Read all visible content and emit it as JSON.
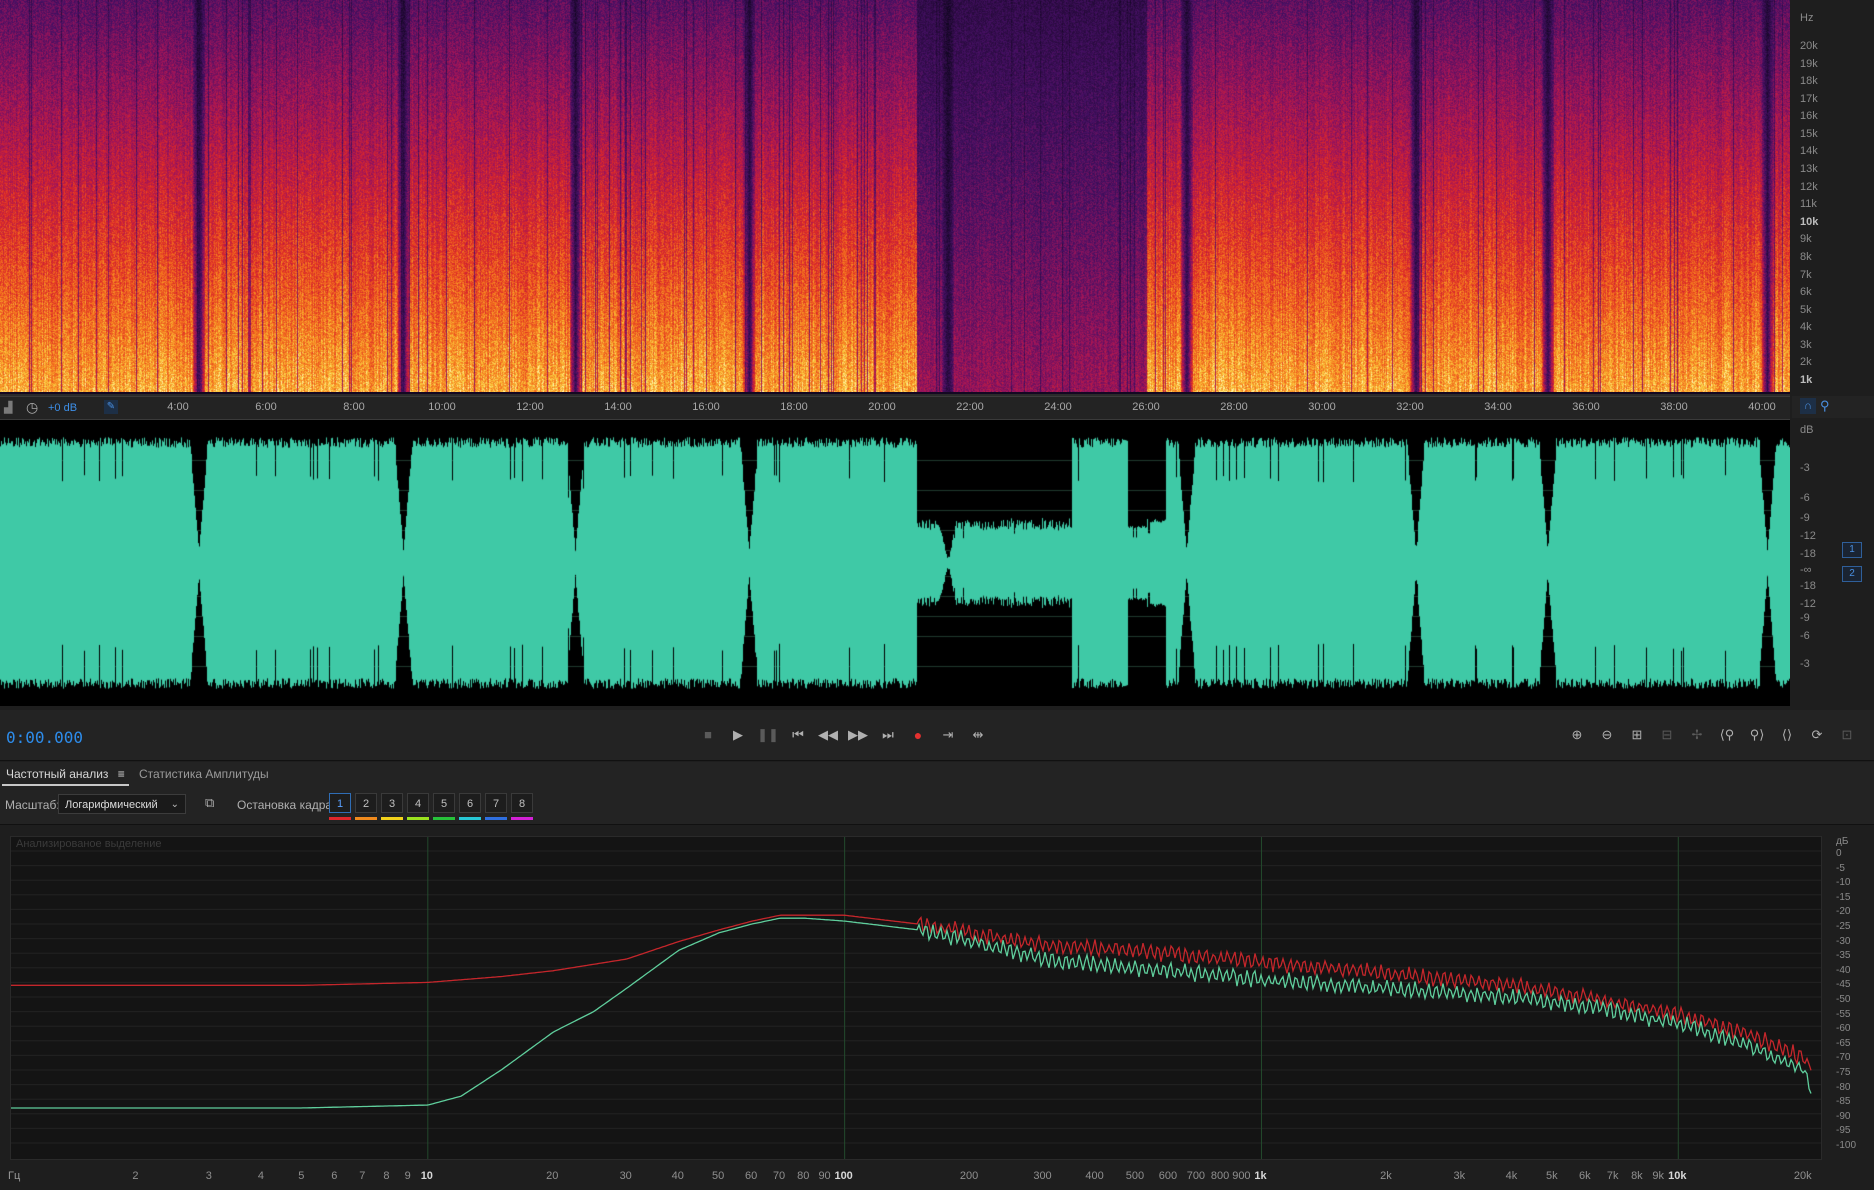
{
  "spectrogram": {
    "unit_label": "Hz",
    "ticks": [
      {
        "label": "20k",
        "bold": false
      },
      {
        "label": "19k",
        "bold": false
      },
      {
        "label": "18k",
        "bold": false
      },
      {
        "label": "17k",
        "bold": false
      },
      {
        "label": "16k",
        "bold": false
      },
      {
        "label": "15k",
        "bold": false
      },
      {
        "label": "14k",
        "bold": false
      },
      {
        "label": "13k",
        "bold": false
      },
      {
        "label": "12k",
        "bold": false
      },
      {
        "label": "11k",
        "bold": false
      },
      {
        "label": "10k",
        "bold": true
      },
      {
        "label": "9k",
        "bold": false
      },
      {
        "label": "8k",
        "bold": false
      },
      {
        "label": "7k",
        "bold": false
      },
      {
        "label": "6k",
        "bold": false
      },
      {
        "label": "5k",
        "bold": false
      },
      {
        "label": "4k",
        "bold": false
      },
      {
        "label": "3k",
        "bold": false
      },
      {
        "label": "2k",
        "bold": false
      },
      {
        "label": "1k",
        "bold": true
      }
    ]
  },
  "timeline": {
    "gain_label": "+0 dB",
    "labels": [
      "4:00",
      "6:00",
      "8:00",
      "10:00",
      "12:00",
      "14:00",
      "16:00",
      "18:00",
      "20:00",
      "22:00",
      "24:00",
      "26:00",
      "28:00",
      "30:00",
      "32:00",
      "34:00",
      "36:00",
      "38:00",
      "40:00"
    ]
  },
  "waveform": {
    "color": "#3fc9a6",
    "db_unit": "dB",
    "db_ticks": [
      "-3",
      "-6",
      "-9",
      "-12",
      "-18",
      "-∞",
      "-18",
      "-12",
      "-9",
      "-6",
      "-3"
    ],
    "channels": [
      "1",
      "2"
    ]
  },
  "transport": {
    "time": "0:00.000"
  },
  "panel": {
    "tabs": [
      {
        "label": "Частотный анализ",
        "active": true
      },
      {
        "label": "Статистика Амплитуды",
        "active": false
      }
    ],
    "scale_label": "Масштаб:",
    "scale_value": "Логарифмический",
    "freeze_label": "Остановка кадра:",
    "frames": [
      {
        "label": "1",
        "color": "#e0262b"
      },
      {
        "label": "2",
        "color": "#f08a1d"
      },
      {
        "label": "3",
        "color": "#f2d21b"
      },
      {
        "label": "4",
        "color": "#9be31f"
      },
      {
        "label": "5",
        "color": "#27c13a"
      },
      {
        "label": "6",
        "color": "#27c8d6"
      },
      {
        "label": "7",
        "color": "#2f6fe0"
      },
      {
        "label": "8",
        "color": "#d321d6"
      }
    ]
  },
  "freq_analysis": {
    "overlay_label": "Анализированое выделение",
    "db_unit": "дБ",
    "db_ticks": [
      "0",
      "-5",
      "-10",
      "-15",
      "-20",
      "-25",
      "-30",
      "-35",
      "-40",
      "-45",
      "-50",
      "-55",
      "-60",
      "-65",
      "-70",
      "-75",
      "-80",
      "-85",
      "-90",
      "-95",
      "-100"
    ],
    "x_unit": "Гц",
    "x_ticks": [
      {
        "label": "2",
        "hz": 2,
        "bold": false
      },
      {
        "label": "3",
        "hz": 3,
        "bold": false
      },
      {
        "label": "4",
        "hz": 4,
        "bold": false
      },
      {
        "label": "5",
        "hz": 5,
        "bold": false
      },
      {
        "label": "6",
        "hz": 6,
        "bold": false
      },
      {
        "label": "7",
        "hz": 7,
        "bold": false
      },
      {
        "label": "8",
        "hz": 8,
        "bold": false
      },
      {
        "label": "9",
        "hz": 9,
        "bold": false
      },
      {
        "label": "10",
        "hz": 10,
        "bold": true
      },
      {
        "label": "20",
        "hz": 20,
        "bold": false
      },
      {
        "label": "30",
        "hz": 30,
        "bold": false
      },
      {
        "label": "40",
        "hz": 40,
        "bold": false
      },
      {
        "label": "50",
        "hz": 50,
        "bold": false
      },
      {
        "label": "60",
        "hz": 60,
        "bold": false
      },
      {
        "label": "70",
        "hz": 70,
        "bold": false
      },
      {
        "label": "80",
        "hz": 80,
        "bold": false
      },
      {
        "label": "90",
        "hz": 90,
        "bold": false
      },
      {
        "label": "100",
        "hz": 100,
        "bold": true
      },
      {
        "label": "200",
        "hz": 200,
        "bold": false
      },
      {
        "label": "300",
        "hz": 300,
        "bold": false
      },
      {
        "label": "400",
        "hz": 400,
        "bold": false
      },
      {
        "label": "500",
        "hz": 500,
        "bold": false
      },
      {
        "label": "600",
        "hz": 600,
        "bold": false
      },
      {
        "label": "700",
        "hz": 700,
        "bold": false
      },
      {
        "label": "800",
        "hz": 800,
        "bold": false
      },
      {
        "label": "900",
        "hz": 900,
        "bold": false
      },
      {
        "label": "1k",
        "hz": 1000,
        "bold": true
      },
      {
        "label": "2k",
        "hz": 2000,
        "bold": false
      },
      {
        "label": "3k",
        "hz": 3000,
        "bold": false
      },
      {
        "label": "4k",
        "hz": 4000,
        "bold": false
      },
      {
        "label": "5k",
        "hz": 5000,
        "bold": false
      },
      {
        "label": "6k",
        "hz": 6000,
        "bold": false
      },
      {
        "label": "7k",
        "hz": 7000,
        "bold": false
      },
      {
        "label": "8k",
        "hz": 8000,
        "bold": false
      },
      {
        "label": "9k",
        "hz": 9000,
        "bold": false
      },
      {
        "label": "10k",
        "hz": 10000,
        "bold": true
      },
      {
        "label": "20k",
        "hz": 20000,
        "bold": false
      }
    ],
    "series": [
      {
        "color": "#c4262b",
        "points": [
          [
            1,
            -46
          ],
          [
            5,
            -46
          ],
          [
            10,
            -45
          ],
          [
            15,
            -43
          ],
          [
            20,
            -41
          ],
          [
            30,
            -37
          ],
          [
            40,
            -31
          ],
          [
            50,
            -27
          ],
          [
            60,
            -24
          ],
          [
            70,
            -22
          ],
          [
            80,
            -22
          ],
          [
            100,
            -22
          ],
          [
            150,
            -25
          ],
          [
            200,
            -28
          ],
          [
            300,
            -32
          ],
          [
            500,
            -34
          ],
          [
            1000,
            -38
          ],
          [
            2000,
            -42
          ],
          [
            4000,
            -46
          ],
          [
            6000,
            -50
          ],
          [
            10000,
            -56
          ],
          [
            15000,
            -63
          ],
          [
            20000,
            -71
          ],
          [
            22000,
            -78
          ]
        ]
      },
      {
        "color": "#5fce9c",
        "points": [
          [
            1,
            -88
          ],
          [
            5,
            -88
          ],
          [
            10,
            -87
          ],
          [
            12,
            -84
          ],
          [
            15,
            -75
          ],
          [
            20,
            -62
          ],
          [
            25,
            -55
          ],
          [
            30,
            -47
          ],
          [
            40,
            -34
          ],
          [
            50,
            -28
          ],
          [
            60,
            -25
          ],
          [
            70,
            -23
          ],
          [
            80,
            -23
          ],
          [
            100,
            -24
          ],
          [
            150,
            -27
          ],
          [
            200,
            -31
          ],
          [
            300,
            -37
          ],
          [
            500,
            -40
          ],
          [
            1000,
            -44
          ],
          [
            2000,
            -47
          ],
          [
            4000,
            -50
          ],
          [
            6000,
            -53
          ],
          [
            10000,
            -59
          ],
          [
            15000,
            -67
          ],
          [
            20000,
            -75
          ],
          [
            22000,
            -92
          ]
        ]
      }
    ]
  }
}
